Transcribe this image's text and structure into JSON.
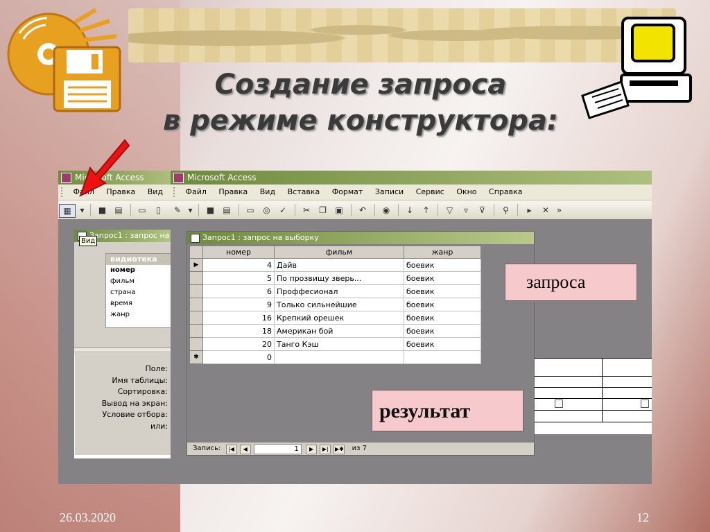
{
  "slide": {
    "title_line1": "Создание запроса",
    "title_line2": "в режиме конструктора:",
    "date": "26.03.2020",
    "page": "12"
  },
  "icons": [
    "cd-floppy-icon",
    "computer-icon",
    "red-arrow-icon"
  ],
  "window_left": {
    "title": "Microsoft Access",
    "menu": [
      "Файл",
      "Правка",
      "Вид",
      "В"
    ],
    "tooltip": "Вид",
    "child_title": "Запрос1 : запрос на",
    "fieldlist": {
      "header": "видиотека",
      "fields": [
        "номер",
        "фильм",
        "страна",
        "время",
        "жанр"
      ]
    },
    "grid_labels": [
      "Поле:",
      "Имя таблицы:",
      "Сортировка:",
      "Вывод на экран:",
      "Условие отбора:",
      "или:"
    ]
  },
  "window_right": {
    "title": "Microsoft Access",
    "menu": [
      "Файл",
      "Правка",
      "Вид",
      "Вставка",
      "Формат",
      "Записи",
      "Сервис",
      "Окно",
      "Справка"
    ],
    "datasheet_title": "Запрос1 : запрос на выборку",
    "columns": [
      "номер",
      "фильм",
      "жанр"
    ],
    "rows": [
      {
        "nomer": "4",
        "film": "Дайв",
        "zhanr": "боевик"
      },
      {
        "nomer": "5",
        "film": "По прозвищу зверь...",
        "zhanr": "боевик"
      },
      {
        "nomer": "6",
        "film": "Проффесионал",
        "zhanr": "боевик"
      },
      {
        "nomer": "9",
        "film": "Только сильнейшие",
        "zhanr": "боевик"
      },
      {
        "nomer": "16",
        "film": "Крепкий орешек",
        "zhanr": "боевик"
      },
      {
        "nomer": "18",
        "film": "Американ бой",
        "zhanr": "боевик"
      },
      {
        "nomer": "20",
        "film": "Танго Кэш",
        "zhanr": "боевик"
      }
    ],
    "new_row_value": "0",
    "nav": {
      "label": "Запись:",
      "current": "1",
      "of_text": "из 7"
    }
  },
  "callouts": {
    "top": "запроса",
    "bottom": "результат"
  },
  "colors": {
    "titlebar": "#6e8a3c",
    "callout": "#f6c9cc",
    "access_gray": "#848284"
  }
}
